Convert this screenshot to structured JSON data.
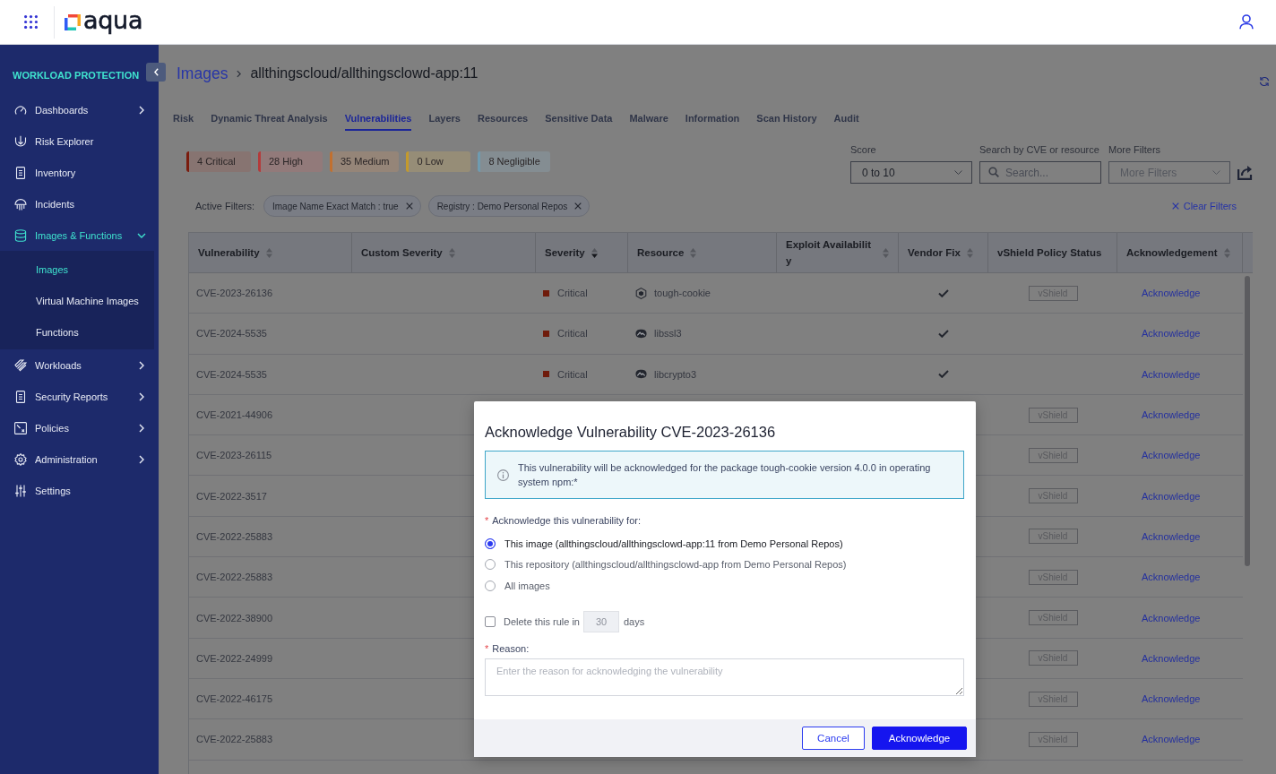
{
  "header": {
    "logo": "aqua"
  },
  "sidebar": {
    "section_title": "WORKLOAD PROTECTION",
    "items": [
      {
        "label": "Dashboards",
        "kind": "group",
        "expanded": false,
        "selected": false
      },
      {
        "label": "Risk Explorer",
        "kind": "link",
        "selected": false
      },
      {
        "label": "Inventory",
        "kind": "link",
        "selected": false
      },
      {
        "label": "Incidents",
        "kind": "link",
        "selected": false
      },
      {
        "label": "Images & Functions",
        "kind": "group",
        "expanded": true,
        "selected": true,
        "children": [
          {
            "label": "Images",
            "selected": true
          },
          {
            "label": "Virtual Machine Images",
            "selected": false
          },
          {
            "label": "Functions",
            "selected": false
          }
        ]
      },
      {
        "label": "Workloads",
        "kind": "group",
        "expanded": false,
        "selected": false
      },
      {
        "label": "Security Reports",
        "kind": "group",
        "expanded": false,
        "selected": false
      },
      {
        "label": "Policies",
        "kind": "group",
        "expanded": false,
        "selected": false
      },
      {
        "label": "Administration",
        "kind": "group",
        "expanded": false,
        "selected": false
      },
      {
        "label": "Settings",
        "kind": "link",
        "selected": false
      }
    ]
  },
  "breadcrumb": [
    {
      "label": "Images",
      "kind": "link"
    },
    {
      "label": "allthingscloud/allthingsclowd-app:11",
      "kind": "current"
    }
  ],
  "tabs": [
    {
      "label": "Risk",
      "selected": false
    },
    {
      "label": "Dynamic Threat Analysis",
      "selected": false
    },
    {
      "label": "Vulnerabilities",
      "selected": true
    },
    {
      "label": "Layers",
      "selected": false
    },
    {
      "label": "Resources",
      "selected": false
    },
    {
      "label": "Sensitive Data",
      "selected": false
    },
    {
      "label": "Malware",
      "selected": false
    },
    {
      "label": "Information",
      "selected": false
    },
    {
      "label": "Scan History",
      "selected": false
    },
    {
      "label": "Audit",
      "selected": false
    }
  ],
  "severity_summary": [
    {
      "label": "4 Critical",
      "color": "#7a1c0e"
    },
    {
      "label": "28 High",
      "color": "#b33b3b"
    },
    {
      "label": "35 Medium",
      "color": "#c2702f"
    },
    {
      "label": "0 Low",
      "color": "#c49a2c"
    },
    {
      "label": "8 Negligible",
      "color": "#6e9bb0"
    }
  ],
  "filters": {
    "score": {
      "label": "Score",
      "value": "0 to 10"
    },
    "search": {
      "label": "Search by CVE or resource",
      "placeholder": "Search..."
    },
    "more_filters": {
      "label": "More Filters",
      "placeholder": "More Filters"
    }
  },
  "active_filters": {
    "label": "Active Filters:",
    "chips": [
      "Image Name Exact Match : true",
      "Registry : Demo Personal Repos"
    ],
    "clear_label": "Clear Filters"
  },
  "table": {
    "columns": [
      {
        "label": "Vulnerability",
        "sortable": true,
        "sorted_descending": false
      },
      {
        "label": "Custom Severity",
        "sortable": true,
        "sorted_descending": false
      },
      {
        "label": "Severity",
        "sortable": true,
        "sorted_descending": true
      },
      {
        "label": "Resource",
        "sortable": true,
        "sorted_descending": false
      },
      {
        "label": "Exploit Availability",
        "sortable": true,
        "sorted_descending": false
      },
      {
        "label": "Vendor Fix",
        "sortable": true,
        "sorted_descending": false
      },
      {
        "label": "vShield Policy Status",
        "sortable": false,
        "sorted_descending": false
      },
      {
        "label": "Acknowledgement",
        "sortable": true,
        "sorted_descending": false
      }
    ],
    "rows": [
      {
        "vulnerability": "CVE-2023-26136",
        "severity": {
          "label": "Critical",
          "color": "#6f1b0b"
        },
        "resource": {
          "name": "tough-cookie",
          "kind": "npm"
        },
        "vendor_fix": true,
        "vshield": "vShield",
        "acknowledgement": "Acknowledge"
      },
      {
        "vulnerability": "CVE-2024-5535",
        "severity": {
          "label": "Critical",
          "color": "#6f1b0b"
        },
        "resource": {
          "name": "libssl3",
          "kind": "os"
        },
        "vendor_fix": true,
        "acknowledgement": "Acknowledge"
      },
      {
        "vulnerability": "CVE-2024-5535",
        "severity": {
          "label": "Critical",
          "color": "#6f1b0b"
        },
        "resource": {
          "name": "libcrypto3",
          "kind": "os"
        },
        "vendor_fix": true,
        "acknowledgement": "Acknowledge"
      },
      {
        "vulnerability": "CVE-2021-44906",
        "vshield": "vShield",
        "acknowledgement": "Acknowledge"
      },
      {
        "vulnerability": "CVE-2023-26115",
        "vshield": "vShield",
        "acknowledgement": "Acknowledge"
      },
      {
        "vulnerability": "CVE-2022-3517",
        "vshield": "vShield",
        "acknowledgement": "Acknowledge"
      },
      {
        "vulnerability": "CVE-2022-25883",
        "vshield": "vShield",
        "acknowledgement": "Acknowledge"
      },
      {
        "vulnerability": "CVE-2022-25883",
        "vshield": "vShield",
        "acknowledgement": "Acknowledge"
      },
      {
        "vulnerability": "CVE-2022-38900",
        "vshield": "vShield",
        "acknowledgement": "Acknowledge"
      },
      {
        "vulnerability": "CVE-2022-24999",
        "vshield": "vShield",
        "acknowledgement": "Acknowledge"
      },
      {
        "vulnerability": "CVE-2022-46175",
        "vshield": "vShield",
        "acknowledgement": "Acknowledge"
      },
      {
        "vulnerability": "CVE-2022-25883",
        "vshield": "vShield",
        "acknowledgement": "Acknowledge"
      }
    ]
  },
  "dialog": {
    "title": "Acknowledge Vulnerability CVE-2023-26136",
    "info": "This vulnerability will be acknowledged for the package tough-cookie version 4.0.0 in operating system npm:*",
    "scope": {
      "label": "Acknowledge this vulnerability for:",
      "required_mark": "*",
      "options": [
        {
          "label": "This image (allthingscloud/allthingsclowd-app:11 from Demo Personal Repos)",
          "selected": true
        },
        {
          "label": "This repository (allthingscloud/allthingsclowd-app from Demo Personal Repos)",
          "selected": false
        },
        {
          "label": "All images",
          "selected": false
        }
      ]
    },
    "expiry": {
      "label": "Delete this rule in",
      "checked": false,
      "value": "30",
      "unit": "days"
    },
    "reason": {
      "label": "Reason:",
      "required_mark": "*",
      "placeholder": "Enter the reason for acknowledging the vulnerability"
    },
    "buttons": [
      {
        "label": "Cancel",
        "kind": "secondary"
      },
      {
        "label": "Acknowledge",
        "kind": "primary"
      }
    ]
  }
}
